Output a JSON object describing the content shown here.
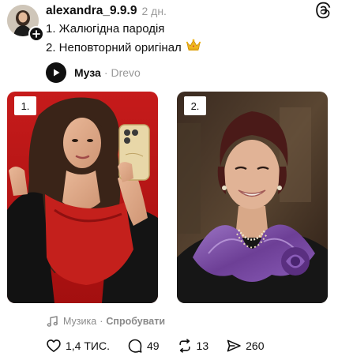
{
  "post": {
    "username": "alexandra_9.9.9",
    "timestamp": "2 дн.",
    "caption_lines": [
      "1. Жалюгідна пародія",
      "2. Неповторний оригінал"
    ],
    "caption_emoji": "crown-emoji"
  },
  "icons": {
    "app_logo": "threads-icon",
    "follow": "plus-icon",
    "play": "play-icon",
    "music_note": "music-note-icon",
    "like": "heart-icon",
    "comment": "comment-icon",
    "repost": "repost-icon",
    "share": "send-icon"
  },
  "music": {
    "song": "Муза",
    "separator": "·",
    "artist": "Drevo"
  },
  "photos": [
    {
      "label": "1."
    },
    {
      "label": "2."
    }
  ],
  "music_prompt": {
    "label": "Музика",
    "separator": "·",
    "action": "Спробувати"
  },
  "actions": {
    "likes": "1,4 ТИС.",
    "comments": "49",
    "reposts": "13",
    "shares": "260"
  },
  "colors": {
    "text": "#101010",
    "muted": "#9a9a9a",
    "dress_red": "#c4201c",
    "blouse_purple": "#7a4f9e"
  }
}
